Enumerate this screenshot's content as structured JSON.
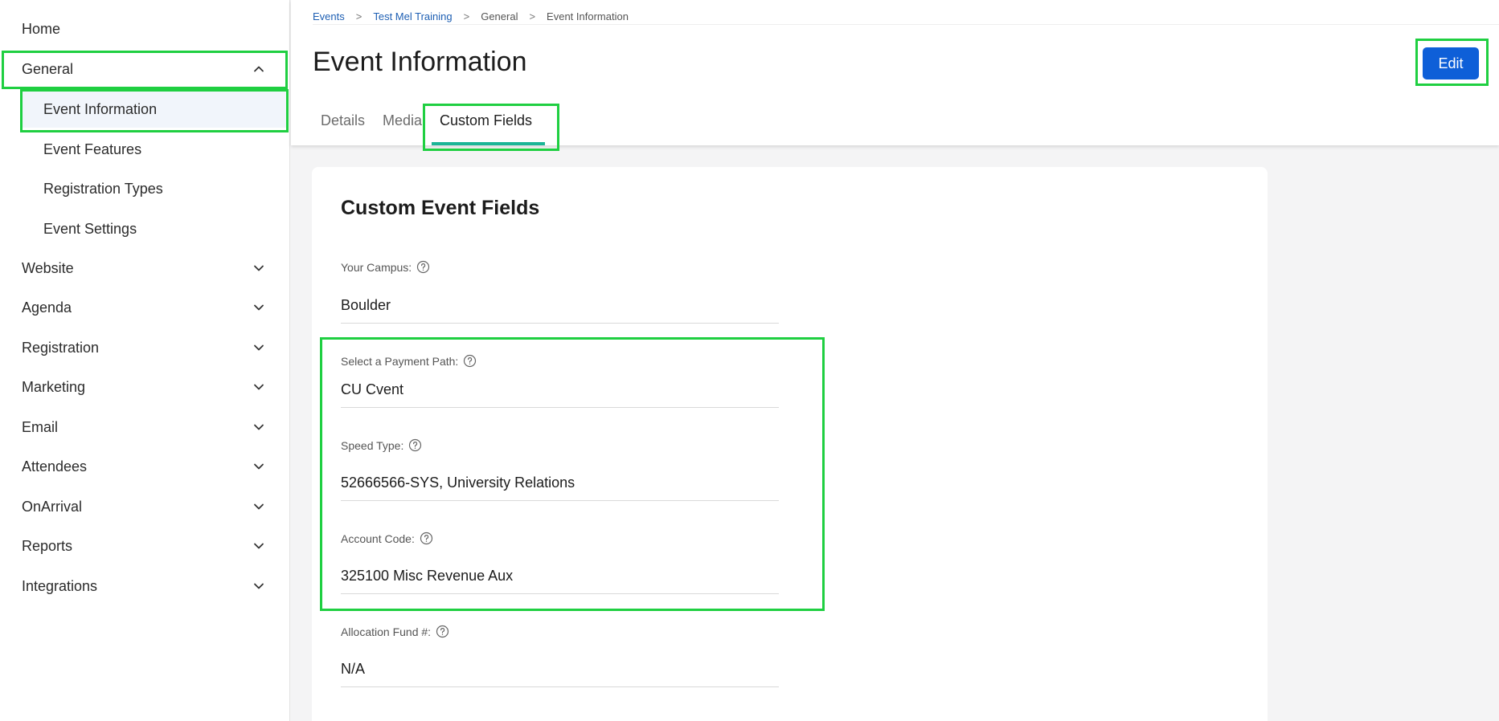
{
  "sidebar": {
    "home": "Home",
    "general": "General",
    "general_children": [
      "Event Information",
      "Event Features",
      "Registration Types",
      "Event Settings"
    ],
    "sections": [
      "Website",
      "Agenda",
      "Registration",
      "Marketing",
      "Email",
      "Attendees",
      "OnArrival",
      "Reports",
      "Integrations"
    ]
  },
  "breadcrumb": {
    "items": [
      "Events",
      "Test Mel Training",
      "General",
      "Event Information"
    ],
    "separator": ">"
  },
  "header": {
    "title": "Event Information",
    "edit_label": "Edit",
    "tabs": [
      "Details",
      "Media",
      "Custom Fields"
    ],
    "active_tab": "Custom Fields"
  },
  "card": {
    "title": "Custom Event Fields",
    "fields": [
      {
        "label": "Your Campus:",
        "value": "Boulder"
      },
      {
        "label": "Select a Payment Path:",
        "value": "CU Cvent"
      },
      {
        "label": "Speed Type:",
        "value": "52666566-SYS, University Relations"
      },
      {
        "label": "Account Code:",
        "value": "325100 Misc Revenue Aux"
      },
      {
        "label": "Allocation Fund #:",
        "value": "N/A"
      }
    ]
  },
  "colors": {
    "accent": "#0e5fd8",
    "link": "#1e5fb3",
    "tab_underline": "#1bb596",
    "highlight": "#1fcf41",
    "active_nav_bg": "#f1f5fb"
  },
  "icons": {
    "expanded": "chevron-up-icon",
    "collapsed": "chevron-down-icon",
    "help": "question-circle-icon"
  }
}
